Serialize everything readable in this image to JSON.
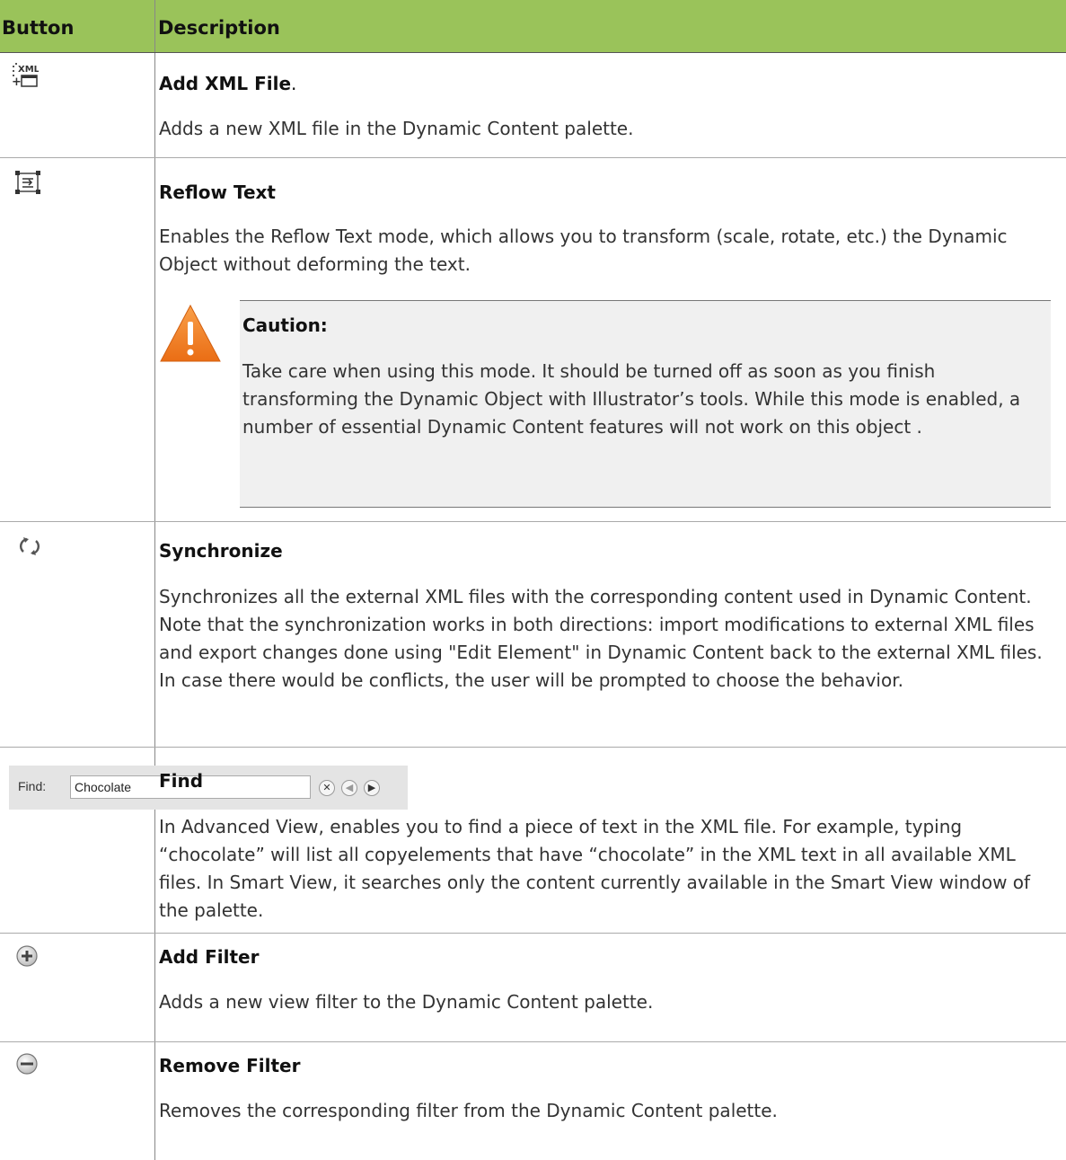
{
  "header": {
    "button_col": "Button",
    "description_col": "Description"
  },
  "rows": [
    {
      "icon": "add-xml-file-icon",
      "title": "Add XML File",
      "title_suffix": ".",
      "description": "Adds a new XML file in the Dynamic Content palette."
    },
    {
      "icon": "reflow-text-icon",
      "title": "Reflow Text",
      "description": "Enables the Reflow Text mode, which allows you to transform (scale, rotate, etc.) the Dynamic Object without deforming the text."
    },
    {
      "icon": "synchronize-icon",
      "title": "Synchronize",
      "description": "Synchronizes all the external XML files with the corresponding content used in Dynamic Content. Note that the synchronization works in both directions: import modifications to external XML files and export changes done using \"Edit Element\" in Dynamic Content back to the external XML files. In case there would be conflicts, the user will be prompted to choose the behavior."
    },
    {
      "icon": "find-bar",
      "title": "Find",
      "description": "In Advanced View, enables you to find a piece of text in the XML file. For example, typing “chocolate” will list all copyelements that have “chocolate” in the XML text in all available XML files. In Smart View, it searches only the content currently available in the Smart View window of the palette."
    },
    {
      "icon": "add-filter-icon",
      "title": "Add Filter",
      "description": "Adds a new view filter to the Dynamic Content palette."
    },
    {
      "icon": "remove-filter-icon",
      "title": "Remove Filter",
      "description": "Removes the corresponding filter from the Dynamic Content palette."
    }
  ],
  "caution": {
    "title": "Caution:",
    "text": "Take care when using this mode. It should be turned off as soon as you finish transforming the Dynamic Object with Illustrator’s tools. While this mode is enabled, a number of essential Dynamic Content features will not work on this object ."
  },
  "find_bar": {
    "label": "Find:",
    "value": "Chocolate"
  },
  "colors": {
    "header_bg": "#9ac35a",
    "caution_bg": "#f0f0f0",
    "warning": "#f07820"
  }
}
